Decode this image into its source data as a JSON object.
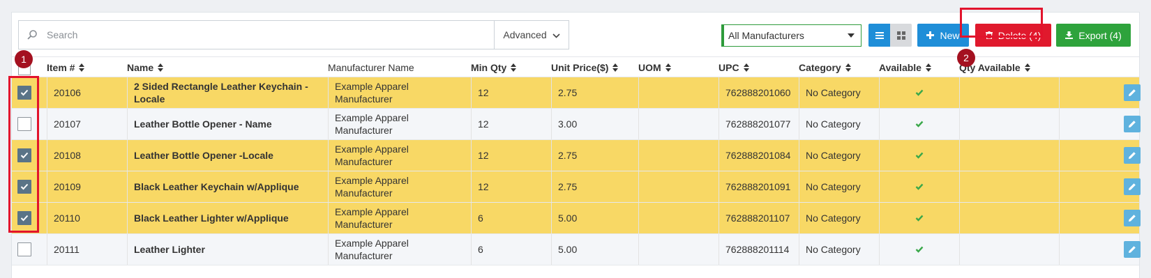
{
  "search": {
    "placeholder": "Search",
    "advanced_label": "Advanced"
  },
  "manufacturer_filter": {
    "selected": "All Manufacturers"
  },
  "buttons": {
    "new_label": "New",
    "delete_label": "Delete (4)",
    "export_label": "Export (4)"
  },
  "annotations": {
    "badge_1": "1",
    "badge_2": "2"
  },
  "columns": [
    "Item #",
    "Name",
    "Manufacturer Name",
    "Min Qty",
    "Unit Price($)",
    "UOM",
    "UPC",
    "Category",
    "Available",
    "Qty Available"
  ],
  "rows": [
    {
      "selected": true,
      "item": "20106",
      "name": "2 Sided Rectangle Leather Keychain - Locale",
      "manufacturer": "Example Apparel Manufacturer",
      "min_qty": "12",
      "price": "2.75",
      "uom": "",
      "upc": "762888201060",
      "category": "No Category"
    },
    {
      "selected": false,
      "item": "20107",
      "name": "Leather Bottle Opener - Name",
      "manufacturer": "Example Apparel Manufacturer",
      "min_qty": "12",
      "price": "3.00",
      "uom": "",
      "upc": "762888201077",
      "category": "No Category"
    },
    {
      "selected": true,
      "item": "20108",
      "name": "Leather Bottle Opener -Locale",
      "manufacturer": "Example Apparel Manufacturer",
      "min_qty": "12",
      "price": "2.75",
      "uom": "",
      "upc": "762888201084",
      "category": "No Category"
    },
    {
      "selected": true,
      "item": "20109",
      "name": "Black Leather Keychain w/Applique",
      "manufacturer": "Example Apparel Manufacturer",
      "min_qty": "12",
      "price": "2.75",
      "uom": "",
      "upc": "762888201091",
      "category": "No Category"
    },
    {
      "selected": true,
      "item": "20110",
      "name": "Black Leather Lighter w/Applique",
      "manufacturer": "Example Apparel Manufacturer",
      "min_qty": "6",
      "price": "5.00",
      "uom": "",
      "upc": "762888201107",
      "category": "No Category"
    },
    {
      "selected": false,
      "item": "20111",
      "name": "Leather Lighter",
      "manufacturer": "Example Apparel Manufacturer",
      "min_qty": "6",
      "price": "5.00",
      "uom": "",
      "upc": "762888201114",
      "category": "No Category"
    }
  ],
  "colors": {
    "selected_row": "#f8d865",
    "primary": "#1f8ed8",
    "danger": "#e0192d",
    "success": "#2ea33c",
    "annotation": "#e2132c"
  },
  "icons": [
    "search-icon",
    "chevron-down-icon",
    "list-view-icon",
    "grid-view-icon",
    "plus-icon",
    "trash-icon",
    "download-icon",
    "check-icon",
    "pencil-icon"
  ]
}
